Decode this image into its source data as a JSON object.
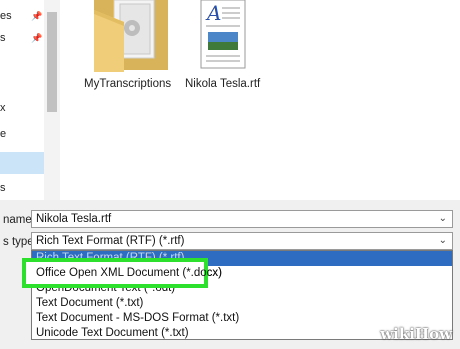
{
  "sidebar": {
    "items": [
      {
        "label": "es",
        "pinned": true
      },
      {
        "label": "s",
        "pinned": true
      },
      {
        "label": "",
        "pinned": false
      },
      {
        "label": "x",
        "pinned": false
      },
      {
        "label": "e",
        "pinned": false
      },
      {
        "label": "s",
        "pinned": false
      }
    ]
  },
  "files": [
    {
      "name": "MyTranscriptions",
      "icon": "folder-icon"
    },
    {
      "name": "Nikola Tesla.rtf",
      "icon": "rtf-document-icon"
    }
  ],
  "save_form": {
    "file_name_label": "name:",
    "file_name_value": "Nikola Tesla.rtf",
    "type_label": "s type:",
    "type_value": "Rich Text Format (RTF) (*.rtf)"
  },
  "type_options": [
    {
      "label": "Rich Text Format (RTF) (*.rtf)",
      "highlighted": true
    },
    {
      "label": "Office Open XML Document (*.docx)",
      "highlighted": false
    },
    {
      "label": "OpenDocument Text (*.odt)",
      "highlighted": false
    },
    {
      "label": "Text Document (*.txt)",
      "highlighted": false
    },
    {
      "label": "Text Document - MS-DOS Format (*.txt)",
      "highlighted": false
    },
    {
      "label": "Unicode Text Document (*.txt)",
      "highlighted": false
    }
  ],
  "callout": {
    "label": "Office Open XML Document (*.docx)"
  },
  "watermark": "wikiHow",
  "colors": {
    "highlight": "#2d6cc0",
    "callout_border": "#2ee02e",
    "folder": "#e8c872"
  }
}
